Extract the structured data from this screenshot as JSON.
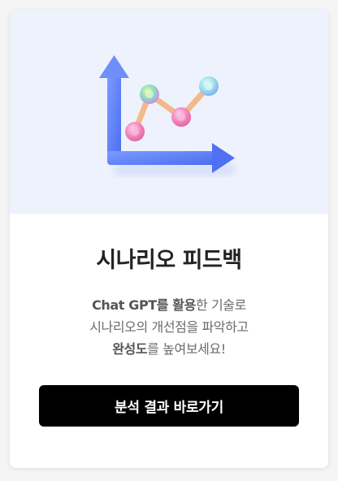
{
  "card": {
    "title": "시나리오 피드백",
    "description": {
      "line1_bold_a": "Chat GPT를 활용",
      "line1_rest": "한 기술로",
      "line2": "시나리오의 개선점을 파악하고",
      "line3_bold": "완성도",
      "line3_rest": "를 높여보세요!"
    },
    "button_label": "분석 결과 바로가기"
  },
  "illustration": {
    "icon": "line-chart-icon",
    "colors": {
      "background": "#eef2fd",
      "axis": "#5b7cf5",
      "node_pink": "#f27fb8",
      "node_green_blue": "#7fd0d6",
      "connector": "#f3b98a"
    }
  },
  "colors": {
    "button_bg": "#000000",
    "button_text": "#ffffff",
    "title": "#222222",
    "body_text": "#6b6b6b"
  }
}
